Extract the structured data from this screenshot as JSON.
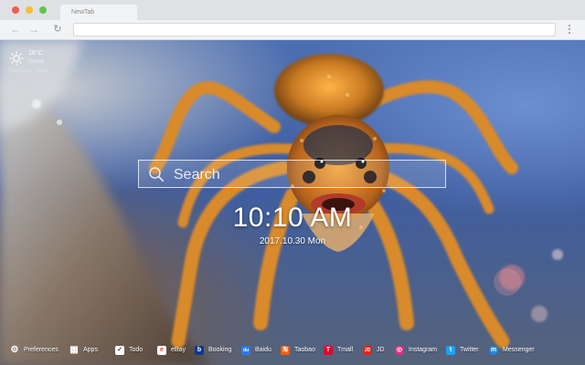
{
  "browser": {
    "tab_title": "NewTab",
    "address": "",
    "nav": {
      "back_glyph": "←",
      "forward_glyph": "→",
      "reload_glyph": "↻"
    }
  },
  "weather": {
    "icon": "sun-icon",
    "temperature": "16°C",
    "condition": "Sunny",
    "location": "Chongqing , China"
  },
  "search": {
    "placeholder": "Search",
    "value": ""
  },
  "clock": {
    "time": "10:10 AM",
    "date": "2017.10.30 Mon"
  },
  "dock": [
    {
      "label": "Preferences",
      "icon": "gear-icon",
      "color": "#00000000",
      "glyph": "⚙"
    },
    {
      "label": "Apps",
      "icon": "apps-grid-icon",
      "color": "#00000000",
      "glyph": "▦"
    },
    {
      "label": "Todo",
      "icon": "todo-check-icon",
      "color": "#ffffff",
      "glyph": "✓"
    },
    {
      "label": "eBay",
      "icon": "ebay-icon",
      "color": "#ffffff",
      "glyph": "e"
    },
    {
      "label": "Booking",
      "icon": "booking-icon",
      "color": "#0d3a8c",
      "glyph": "b"
    },
    {
      "label": "Baidu",
      "icon": "baidu-icon",
      "color": "#2b7bec",
      "glyph": "du"
    },
    {
      "label": "Taobao",
      "icon": "taobao-icon",
      "color": "#ff5a00",
      "glyph": "淘"
    },
    {
      "label": "Tmall",
      "icon": "tmall-icon",
      "color": "#e4002b",
      "glyph": "T"
    },
    {
      "label": "JD",
      "icon": "jd-icon",
      "color": "#e1251b",
      "glyph": "JD"
    },
    {
      "label": "Instagram",
      "icon": "instagram-icon",
      "color": "#d6307a",
      "glyph": "◎"
    },
    {
      "label": "Twitter",
      "icon": "twitter-icon",
      "color": "#1da1f2",
      "glyph": "t"
    },
    {
      "label": "Messenger",
      "icon": "messenger-icon",
      "color": "#1e88e5",
      "glyph": "m"
    }
  ]
}
